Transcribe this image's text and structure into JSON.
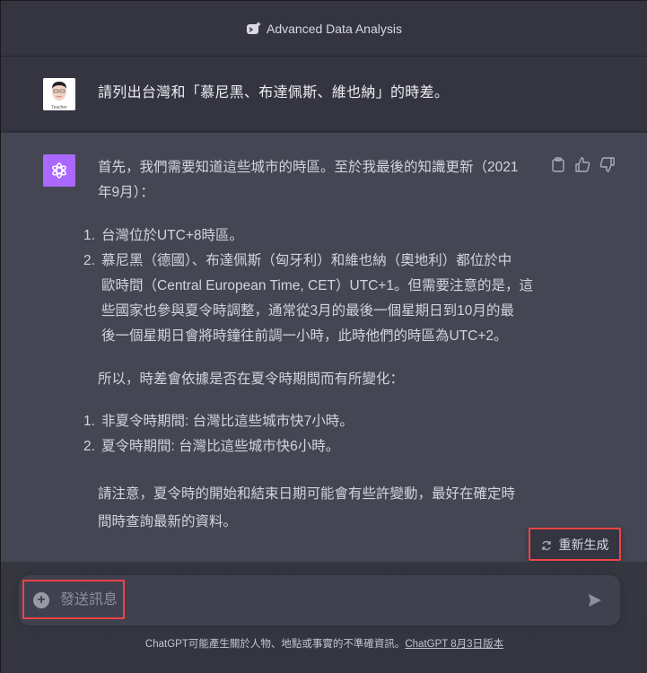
{
  "header": {
    "title": "Advanced Data Analysis",
    "icon": "data-analysis-icon"
  },
  "conversation": {
    "user": {
      "avatar_label": "Teacher",
      "message": "請列出台灣和「慕尼黑、布達佩斯、維也納」的時差。"
    },
    "assistant": {
      "intro_line1": "首先，我們需要知道這些城市的時區。至於我最後的知識更新（2021",
      "intro_line2": "年9月）：",
      "list1": [
        {
          "num": "1.",
          "lines": [
            "台灣位於UTC+8時區。"
          ]
        },
        {
          "num": "2.",
          "lines": [
            "慕尼黑（德國）、布達佩斯（匈牙利）和維也納（奧地利）都位於中",
            "歐時間（Central European Time, CET）UTC+1。但需要注意的是，這",
            "些國家也參與夏令時調整，通常從3月的最後一個星期日到10月的最",
            "後一個星期日會將時鐘往前調一小時，此時他們的時區為UTC+2。"
          ]
        }
      ],
      "so_text": "所以，時差會依據是否在夏令時期間而有所變化：",
      "list2": [
        {
          "num": "1.",
          "text": "非夏令時期間: 台灣比這些城市快7小時。"
        },
        {
          "num": "2.",
          "text": "夏令時期間: 台灣比這些城市快6小時。"
        }
      ],
      "note_line1": "請注意，夏令時的開始和結束日期可能會有些許變動，最好在確定時",
      "note_line2": "間時查詢最新的資料。",
      "actions": [
        "copy-icon",
        "thumbs-up-icon",
        "thumbs-down-icon"
      ]
    }
  },
  "regenerate": {
    "label": "重新生成"
  },
  "composer": {
    "placeholder": "發送訊息",
    "value": ""
  },
  "footer": {
    "disclaimer": "ChatGPT可能產生關於人物、地點或事實的不準確資訊。",
    "version_link": "ChatGPT 8月3日版本"
  },
  "colors": {
    "assistant_avatar": "#ab68ff",
    "highlight": "#ef4444",
    "background": "#343541",
    "assistant_bg": "#444654"
  }
}
